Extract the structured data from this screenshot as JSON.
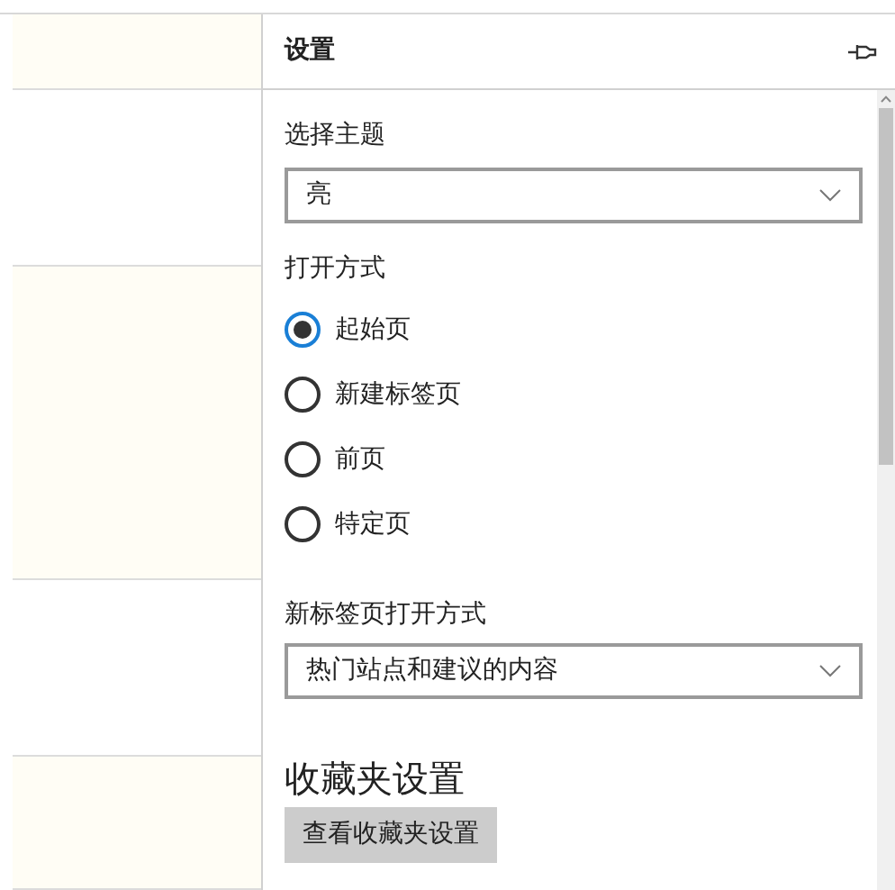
{
  "panel": {
    "title": "设置"
  },
  "theme": {
    "label": "选择主题",
    "value": "亮"
  },
  "open_with": {
    "label": "打开方式",
    "options": [
      {
        "label": "起始页",
        "selected": true
      },
      {
        "label": "新建标签页",
        "selected": false
      },
      {
        "label": "前页",
        "selected": false
      },
      {
        "label": "特定页",
        "selected": false
      }
    ]
  },
  "new_tab": {
    "label": "新标签页打开方式",
    "value": "热门站点和建议的内容"
  },
  "favorites": {
    "heading": "收藏夹设置",
    "button": "查看收藏夹设置"
  }
}
